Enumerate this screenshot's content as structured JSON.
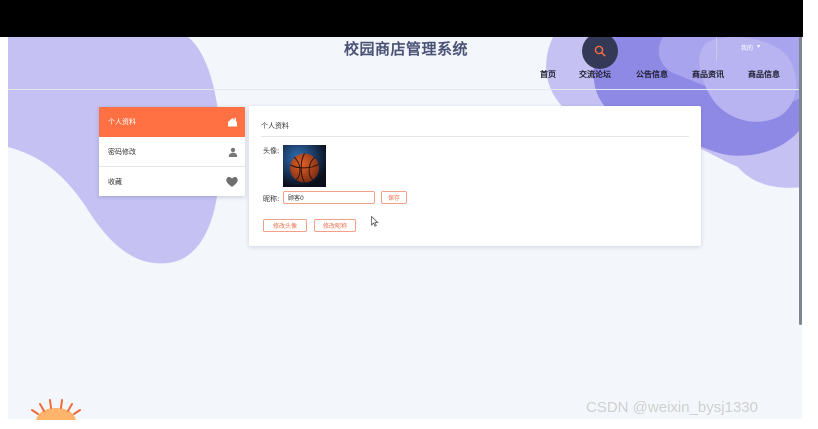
{
  "site": {
    "title": "校园商店管理系统"
  },
  "header": {
    "nav": [
      "首页",
      "交流论坛",
      "公告信息",
      "商品资讯",
      "商品信息"
    ],
    "user_label": "我的",
    "user_caret": "▾"
  },
  "sidebar": {
    "items": [
      {
        "label": "个人资料",
        "icon": "home-icon",
        "active": true
      },
      {
        "label": "密码修改",
        "icon": "person-icon",
        "active": false
      },
      {
        "label": "收藏",
        "icon": "heart-icon",
        "active": false
      }
    ]
  },
  "profile": {
    "title": "个人资料",
    "avatar_label": "头像:",
    "nickname_label": "昵称:",
    "nickname_value": "顾客0",
    "save_label": "保存",
    "change_avatar_label": "修改头像",
    "change_nickname_label": "修改昵称"
  },
  "watermark": "CSDN @weixin_bysj1330",
  "colors": {
    "accent": "#ff7043",
    "blob": "#c5c2f3",
    "blob_dark": "#7f79e0",
    "title": "#4a5275"
  }
}
